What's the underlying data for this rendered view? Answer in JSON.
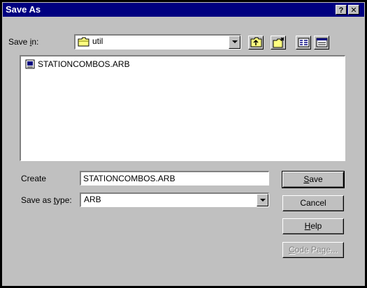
{
  "window": {
    "title": "Save As",
    "help_button": "?",
    "close_button": "✕"
  },
  "save_in": {
    "label_prefix": "Save ",
    "label_accel": "i",
    "label_suffix": "n:",
    "folder": "util"
  },
  "files": [
    {
      "name": "STATIONCOMBOS.ARB",
      "icon": "document-icon"
    }
  ],
  "create": {
    "label": "Create",
    "value": "STATIONCOMBOS.ARB"
  },
  "save_as_type": {
    "label_prefix": "Save as ",
    "label_accel": "t",
    "label_suffix": "ype:",
    "value": "ARB"
  },
  "buttons": {
    "save": {
      "accel": "S",
      "rest": "ave"
    },
    "cancel": {
      "label": "Cancel"
    },
    "help": {
      "accel": "H",
      "rest": "elp"
    },
    "code_page": {
      "accel": "C",
      "rest": "ode Page..."
    }
  }
}
